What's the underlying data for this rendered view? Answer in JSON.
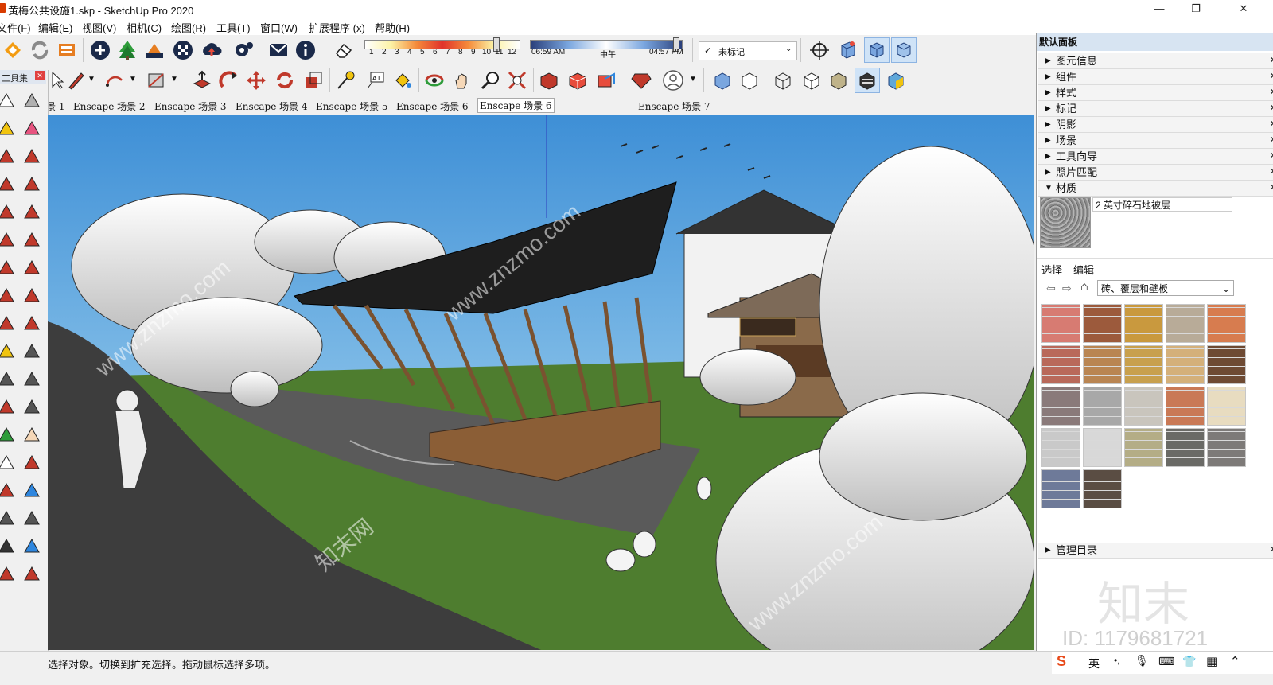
{
  "window": {
    "title": "黄梅公共设施1.skp - SketchUp Pro 2020",
    "minimize": "—",
    "maximize": "❐",
    "close": "✕"
  },
  "menu": [
    "文件(F)",
    "编辑(E)",
    "视图(V)",
    "相机(C)",
    "绘图(R)",
    "工具(T)",
    "窗口(W)",
    "扩展程序 (x)",
    "帮助(H)"
  ],
  "shadow_toolbar": {
    "months": [
      "1",
      "2",
      "3",
      "4",
      "5",
      "6",
      "7",
      "8",
      "9",
      "10",
      "11",
      "12"
    ],
    "time_start": "06:59 AM",
    "time_mid": "中午",
    "time_end": "04:57 PM"
  },
  "tag_select": {
    "check": "✓",
    "value": "未标记"
  },
  "toolset": {
    "title": "工具集",
    "close": "✕"
  },
  "scene_tabs": [
    "景 1",
    "Enscape 场景 2",
    "Enscape 场景 3",
    "Enscape 场景 4",
    "Enscape 场景 5",
    "Enscape 场景 6",
    "Enscape 场景 6",
    "Enscape 场景 7"
  ],
  "tray": {
    "title": "默认面板",
    "panels": [
      "图元信息",
      "组件",
      "样式",
      "标记",
      "阴影",
      "场景",
      "工具向导",
      "照片匹配"
    ],
    "materials": {
      "label": "材质",
      "current_name": "2 英寸碎石地被层",
      "tab_select": "选择",
      "tab_edit": "编辑",
      "category": "砖、覆层和壁板",
      "swatch_colors": [
        "#d77b72",
        "#9c5a3c",
        "#c9993e",
        "#b8ab98",
        "#d77c4f",
        "#b9695a",
        "#b98552",
        "#c8a04d",
        "#d4b07a",
        "#6e4a33",
        "#8a7a7a",
        "#a8a8a8",
        "#c9c5bd",
        "#c97956",
        "#e8dcc0",
        "#c9c9c9",
        "#d8d8d8",
        "#b4ad86",
        "#6a6a66",
        "#7d7a78",
        "#6e7a99",
        "#5a4d43"
      ]
    },
    "manage_catalog": "管理目录"
  },
  "status": {
    "message": "选择对象。切换到扩充选择。拖动鼠标选择多项。"
  },
  "ime": {
    "lang": "英",
    "punct": "•,"
  },
  "watermark": {
    "brand": "知末",
    "id": "ID: 1179681721",
    "site": "www.znzmo.com",
    "site_cn": "知末网"
  },
  "colors": {
    "sky": "#6aaedd",
    "grass": "#4e7d2f",
    "road": "#3d3d3d",
    "tray_head": "#d7e4f2"
  }
}
